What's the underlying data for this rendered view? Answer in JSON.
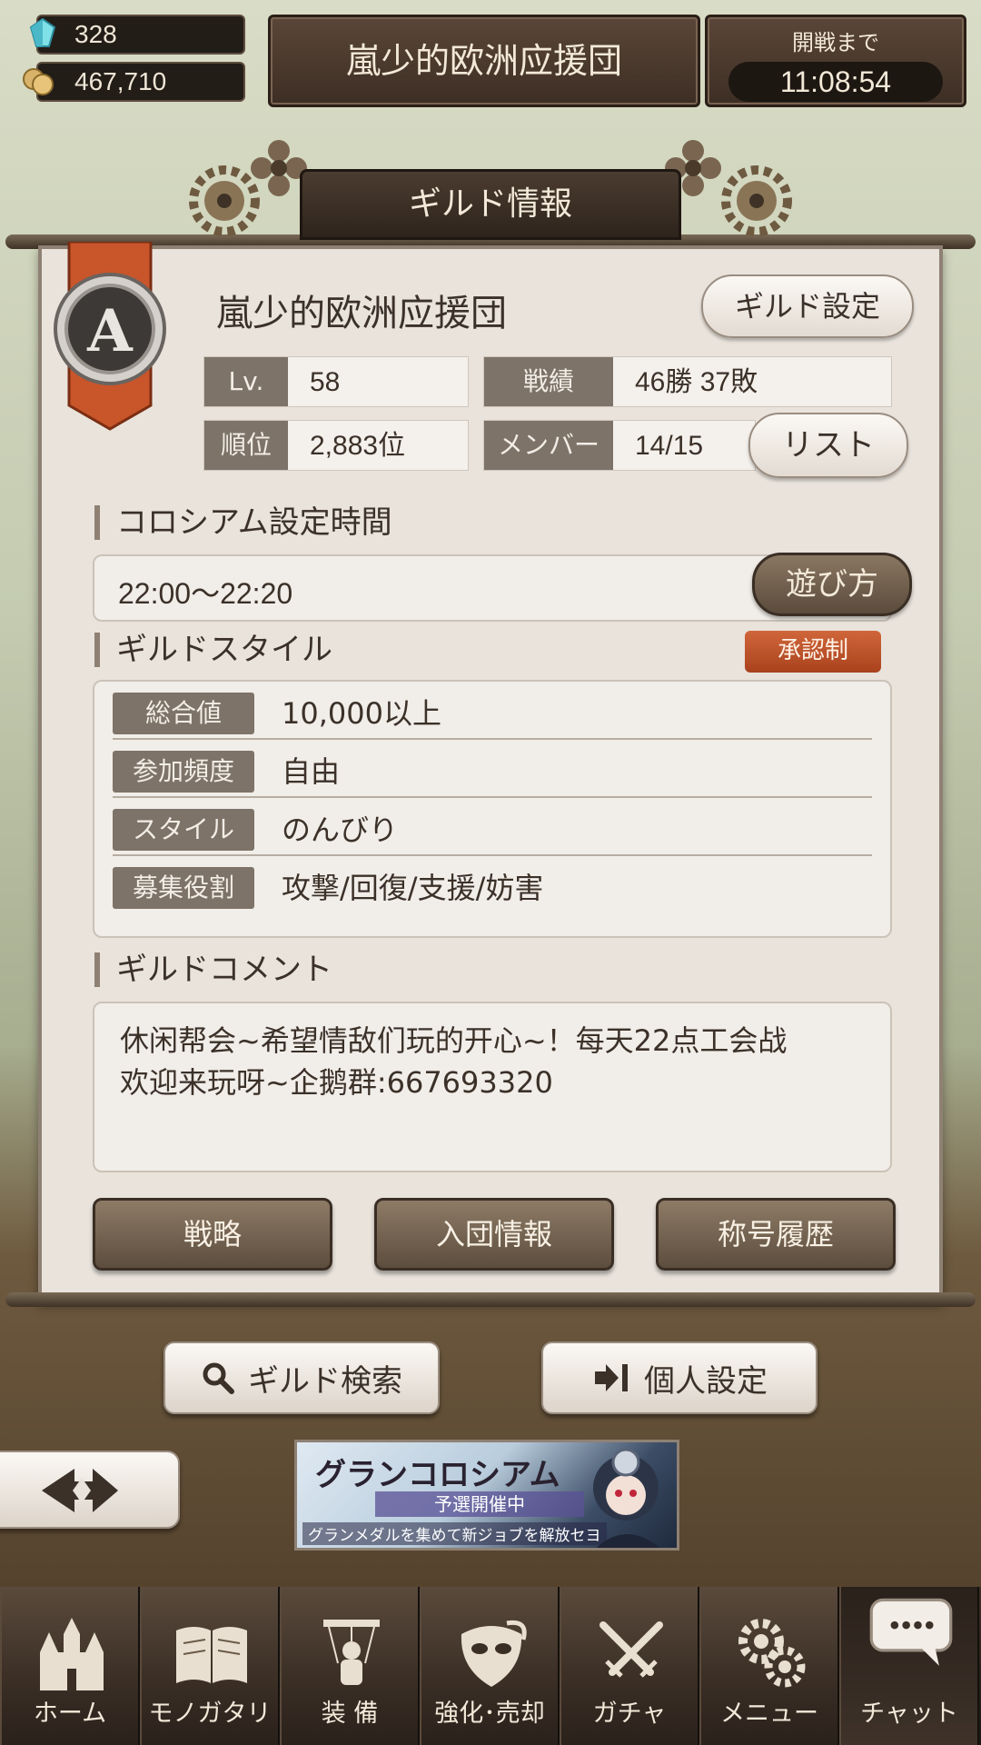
{
  "currency": {
    "gems": "328",
    "coins": "467,710"
  },
  "top_guild_name": "嵐少的欧洲应援団",
  "battle_timer": {
    "label": "開戦まで",
    "value": "11:08:54"
  },
  "panel_title": "ギルド情報",
  "guild": {
    "emblem_letter": "A",
    "name": "嵐少的欧洲应援団",
    "settings_button": "ギルド設定",
    "stats": {
      "level_label": "Lv.",
      "level_value": "58",
      "record_label": "戦績",
      "record_value": "46勝 37敗",
      "rank_label": "順位",
      "rank_value": "2,883位",
      "members_label": "メンバー",
      "members_value": "14/15"
    },
    "list_button": "リスト"
  },
  "colosseum": {
    "title": "コロシアム設定時間",
    "time": "22:00〜22:20",
    "howto_button": "遊び方"
  },
  "guild_style": {
    "title": "ギルドスタイル",
    "badge": "承認制",
    "rows": [
      {
        "label": "総合値",
        "value": "10,000以上"
      },
      {
        "label": "参加頻度",
        "value": "自由"
      },
      {
        "label": "スタイル",
        "value": "のんびり"
      },
      {
        "label": "募集役割",
        "value": "攻撃/回復/支援/妨害"
      }
    ]
  },
  "comment": {
    "title": "ギルドコメント",
    "line1": "休闲帮会~希望情敌们玩的开心~！每天22点工会战",
    "line2": "欢迎来玩呀~企鹅群:667693320"
  },
  "actions": {
    "strategy": "戦略",
    "join_info": "入団情報",
    "title_history": "称号履歴"
  },
  "sub_buttons": {
    "guild_search": "ギルド検索",
    "personal_settings": "個人設定"
  },
  "banner": {
    "title": "グランコロシアム",
    "subtitle": "予選開催中",
    "note": "グランメダルを集めて新ジョブを解放セヨ"
  },
  "nav": [
    {
      "label": "ホーム",
      "icon": "castle-icon"
    },
    {
      "label": "モノガタリ",
      "icon": "book-icon"
    },
    {
      "label": "装 備",
      "icon": "puppet-icon"
    },
    {
      "label": "強化･売却",
      "icon": "mask-icon"
    },
    {
      "label": "ガチャ",
      "icon": "swords-icon"
    },
    {
      "label": "メニュー",
      "icon": "gear-icon"
    },
    {
      "label": "チャット",
      "icon": "chat-bubble-icon"
    }
  ],
  "colors": {
    "accent_brown": "#5b4b3c",
    "panel_bg": "#e9e3dc",
    "badge_orange": "#c2542a"
  }
}
